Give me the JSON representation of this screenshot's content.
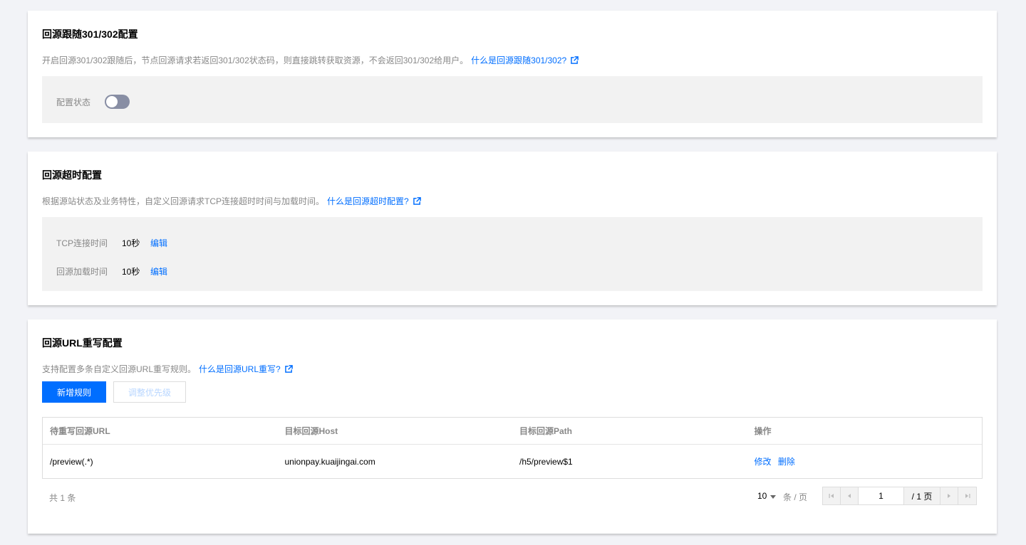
{
  "follow_redirect": {
    "title": "回源跟随301/302配置",
    "description": "开启回源301/302跟随后，节点回源请求若返回301/302状态码，则直接跳转获取资源，不会返回301/302给用户。",
    "help_link": "什么是回源跟随301/302?",
    "status_label": "配置状态",
    "enabled": false
  },
  "timeout": {
    "title": "回源超时配置",
    "description": "根据源站状态及业务特性，自定义回源请求TCP连接超时时间与加载时间。",
    "help_link": "什么是回源超时配置?",
    "tcp_label": "TCP连接时间",
    "tcp_value": "10秒",
    "load_label": "回源加载时间",
    "load_value": "10秒",
    "edit_label": "编辑"
  },
  "url_rewrite": {
    "title": "回源URL重写配置",
    "description": "支持配置多条自定义回源URL重写规则。",
    "help_link": "什么是回源URL重写?",
    "add_button": "新增规则",
    "priority_button": "调整优先级",
    "columns": [
      "待重写回源URL",
      "目标回源Host",
      "目标回源Path",
      "操作"
    ],
    "rows": [
      {
        "url": "/preview(.*)",
        "host": "unionpay.kuaijingai.com",
        "path": "/h5/preview$1",
        "edit": "修改",
        "delete": "删除"
      }
    ],
    "pager": {
      "total": "共 1 条",
      "page_size": "10",
      "page_size_unit": "条 / 页",
      "current_page": "1",
      "total_pages": "/ 1 页"
    }
  },
  "colors": {
    "accent": "#006eff",
    "toggle_off": "#888ea4",
    "panel_bg": "#f2f2f2"
  }
}
